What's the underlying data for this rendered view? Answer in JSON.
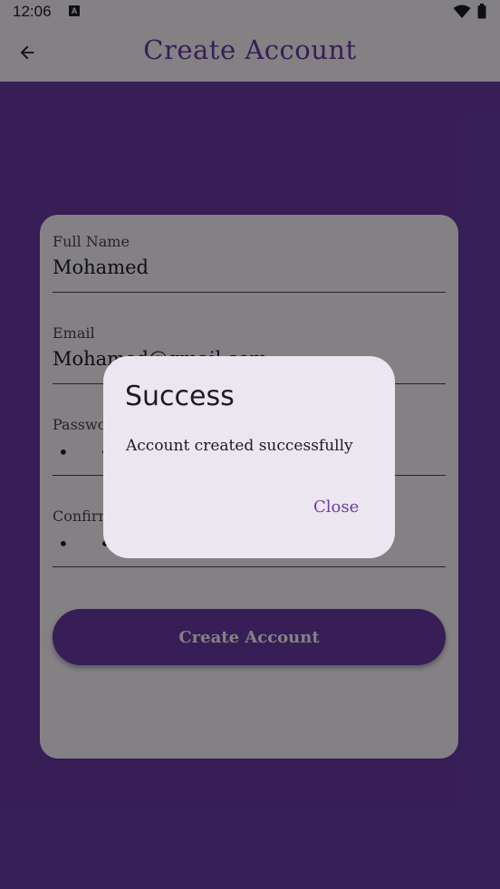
{
  "status_bar": {
    "time": "12:06",
    "icons": [
      "a-icon",
      "wifi-icon",
      "battery-icon"
    ]
  },
  "app_bar": {
    "back_icon": "arrow-left-icon",
    "title": "Create Account"
  },
  "form": {
    "fields": [
      {
        "label": "Full Name",
        "value": "Mohamed"
      },
      {
        "label": "Email",
        "value": "Mohamed@gmail.com"
      },
      {
        "label": "Password",
        "value": "• • • • • • • •"
      },
      {
        "label": "Confirm Password",
        "value": "• • • • • • • •"
      }
    ],
    "submit_label": "Create Account"
  },
  "dialog": {
    "title": "Success",
    "message": "Account created successfully",
    "close_label": "Close"
  },
  "colors": {
    "primary": "#6a3ba6",
    "surface": "#fdf7ff",
    "dialog_surface": "#ece6f0",
    "scrim": "rgba(0,0,0,0.48)"
  }
}
